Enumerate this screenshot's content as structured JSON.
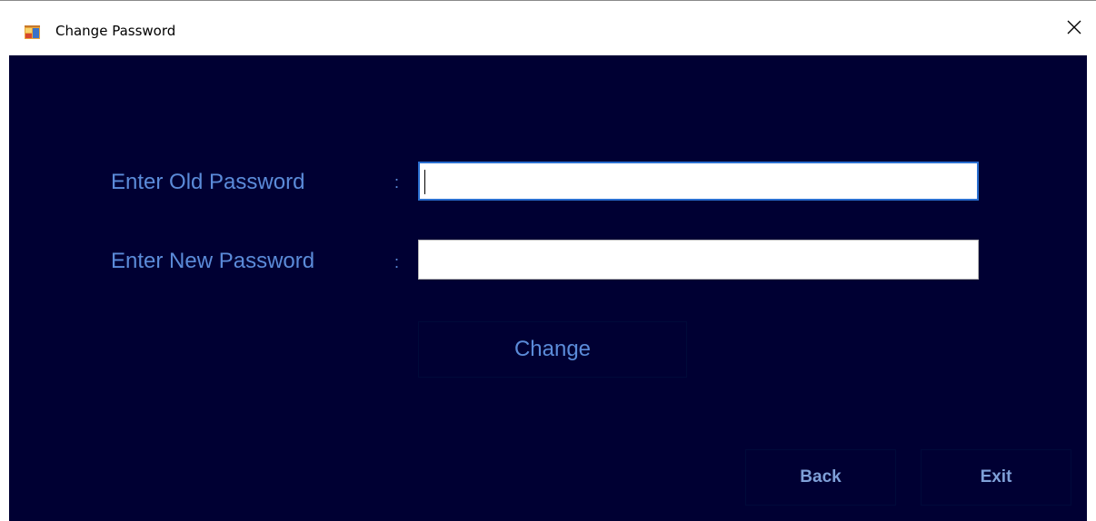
{
  "window": {
    "title": "Change Password",
    "icon": "app-form-icon",
    "close_icon": "close-icon"
  },
  "form": {
    "old_password_label": "Enter Old Password",
    "new_password_label": "Enter New Password",
    "colon": ":",
    "old_password_value": "",
    "new_password_value": "",
    "change_button": "Change"
  },
  "footer": {
    "back_button": "Back",
    "exit_button": "Exit"
  },
  "colors": {
    "background": "#000033",
    "label": "#5b8bd9",
    "focus_border": "#2a6fd0"
  }
}
